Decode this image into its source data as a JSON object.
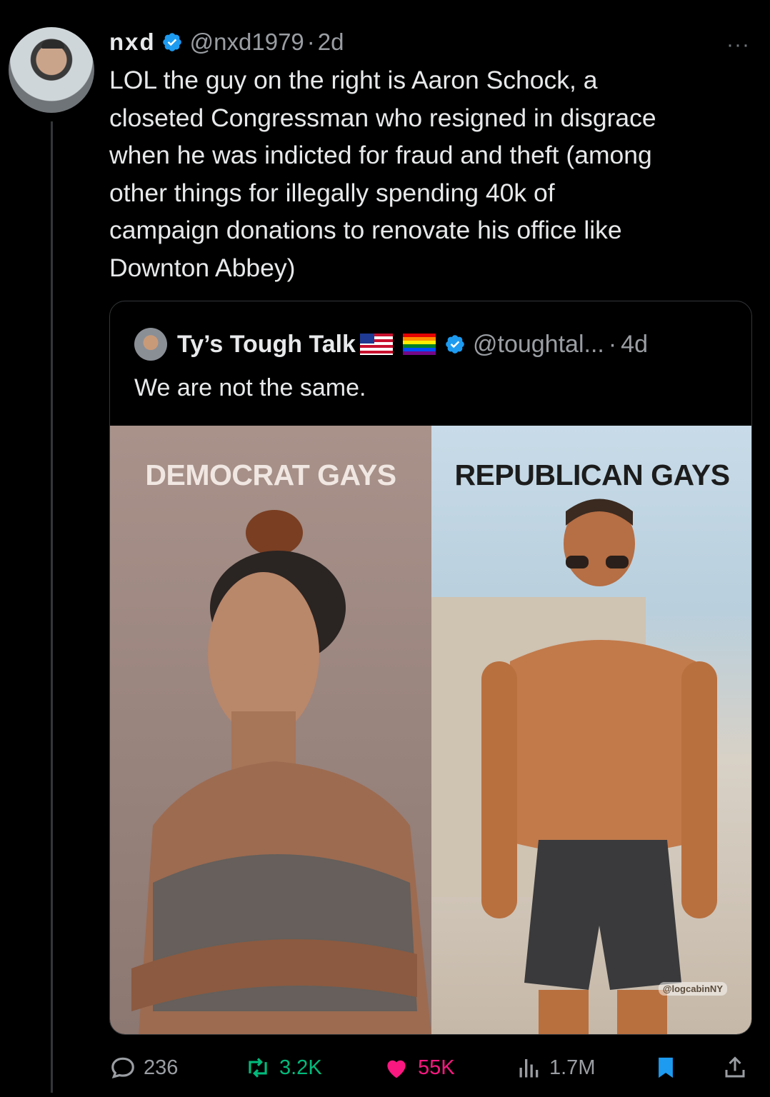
{
  "tweet": {
    "display_name": "nxd",
    "handle": "@nxd1979",
    "separator": "·",
    "time": "2d",
    "text": "LOL the guy on the right is Aaron Schock, a\ncloseted Congressman who resigned in disgrace\nwhen he was indicted for fraud and theft (among\nother things for illegally spending 40k of\ncampaign donations to renovate his office like\nDownton Abbey)",
    "more": "···"
  },
  "quote": {
    "display_name": "Ty’s Tough Talk",
    "handle": "@toughtal...",
    "separator": "·",
    "time": "4d",
    "text": "We are not the same.",
    "media": {
      "left_caption": "DEMOCRAT GAYS",
      "right_caption": "REPUBLICAN GAYS",
      "watermark": "@logcabinNY"
    }
  },
  "actions": {
    "replies": "236",
    "reposts": "3.2K",
    "likes": "55K",
    "views": "1.7M"
  },
  "colors": {
    "verified": "#1d9bf0",
    "repost": "#00ba7c",
    "like": "#f91880",
    "bookmark": "#1d9bf0"
  }
}
